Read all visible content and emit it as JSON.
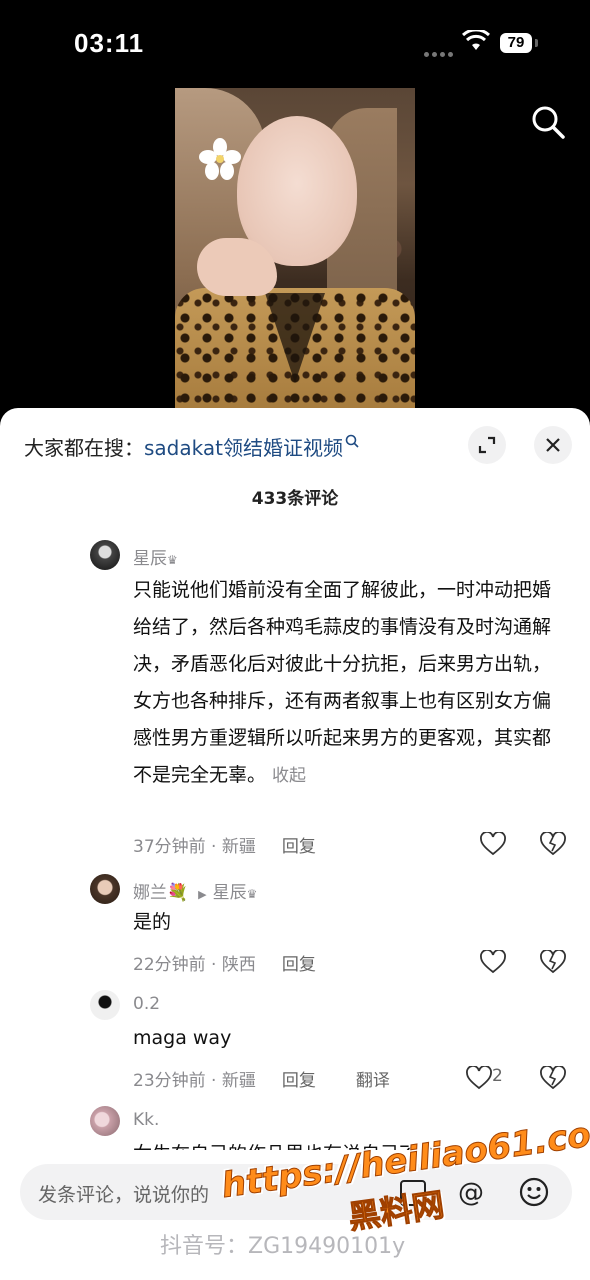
{
  "status_bar": {
    "time": "03:11",
    "battery": "79"
  },
  "search_bar": {
    "prefix": "大家都在搜：",
    "keyword": "sadakat领结婚证视频"
  },
  "comments_header": {
    "count_label": "433条评论"
  },
  "comments": [
    {
      "user": "星辰",
      "text": "只能说他们婚前没有全面了解彼此，一时冲动把婚给结了，然后各种鸡毛蒜皮的事情没有及时沟通解决，矛盾恶化后对彼此十分抗拒，后来男方出轨，女方也各种排斥，还有两者叙事上也有区别女方偏感性男方重逻辑所以听起来男方的更客观，其实都不是完全无辜。",
      "collapse": "收起",
      "meta": "37分钟前 · 新疆",
      "reply": "回复"
    },
    {
      "user": "娜兰💐",
      "reply_to": "星辰",
      "text": "是的",
      "meta": "22分钟前 · 陕西",
      "reply": "回复"
    },
    {
      "user": "0.2",
      "text": "maga way",
      "meta": "23分钟前 · 新疆",
      "reply": "回复",
      "translate": "翻译",
      "likes": "2"
    },
    {
      "user": "Kk.",
      "text": "女生在自己的作品里也有说自己不会"
    }
  ],
  "composer": {
    "placeholder": "发条评论，说说你的"
  },
  "watermark": {
    "line1": "https://heiliao61.com",
    "line2": "黑料网"
  },
  "douyin_id": "抖音号：ZG19490101y",
  "colors": {
    "accent_keyword": "#1f4b82",
    "watermark": "#ff8c1a"
  }
}
